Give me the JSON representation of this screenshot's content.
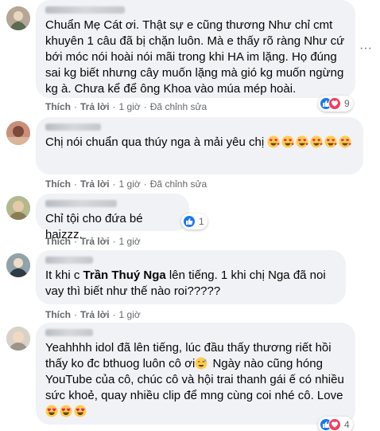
{
  "comments": [
    {
      "text": "Chuẩn Mẹ Cát ơi. Thật sự e cũng thương Như chỉ cmt khuyên 1 câu đã bị chặn luôn. Mà e thấy rõ ràng Như cứ bới móc nói hoài nói mãi trong khi HA im lặng. Họ đúng sai kg biết nhưng cây muốn lặng mà gió kg muốn ngừng kg à. Chưa kể để ông Khoa vào múa mép hoài.",
      "like": "Thích",
      "reply": "Trả lời",
      "time": "1 giờ",
      "edited": "Đã chỉnh sửa",
      "reaction_count": "9",
      "more": "···"
    },
    {
      "text": "Chị nói chuẩn qua thúy nga à mải yêu chị",
      "like": "Thích",
      "reply": "Trả lời",
      "time": "1 giờ",
      "edited": "Đã chỉnh sửa"
    },
    {
      "text": "Chỉ tội cho đứa bé haizzz.",
      "like": "Thích",
      "reply": "Trả lời",
      "time": "1 giờ",
      "reaction_count": "1"
    },
    {
      "text_before": "It khi c",
      "mention": "Trần Thuý Nga",
      "text_after": "lên tiếng. 1 khi chị Nga đã noi vay thì biết như thế nào roi?????",
      "like": "Thích",
      "reply": "Trả lời",
      "time": "1 giờ"
    },
    {
      "text": "Yeahhhh idol đã lên tiếng, lúc đầu thấy thương riết hồi thấy ko đc bthuog luôn cô ơi",
      "text2": "Ngày nào cũng hóng YouTube của cô, chúc cô và hội trai thanh gái ế có nhiều sức khoẻ, quay nhiều clip để mng cùng coi nhé cô. Love",
      "like": "Thích",
      "reply": "Trả lời",
      "time": "1 giờ",
      "reaction_count": "4"
    }
  ],
  "icons": {
    "like": "like-reaction-icon",
    "love": "love-reaction-icon",
    "heart_eyes": "heart-eyes-emoji",
    "sweat": "sweat-smile-emoji",
    "heart_face": "smiling-face-with-hearts-emoji"
  },
  "colors": {
    "like_blue": "#1877f2",
    "love_red": "#f33e58",
    "bubble": "#f0f2f5",
    "meta": "#65676b"
  }
}
